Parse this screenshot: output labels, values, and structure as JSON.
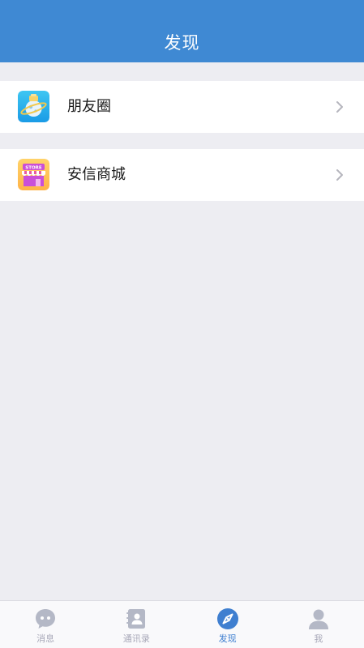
{
  "header": {
    "title": "发现"
  },
  "menu": [
    {
      "label": "朋友圈",
      "icon": "moments-planet-icon"
    },
    {
      "label": "安信商城",
      "icon": "store-shop-icon",
      "badge_text": "STORE"
    }
  ],
  "tabbar": {
    "tabs": [
      {
        "label": "消息",
        "icon": "chat-bubble-icon",
        "active": false
      },
      {
        "label": "通讯录",
        "icon": "contacts-book-icon",
        "active": false
      },
      {
        "label": "发现",
        "icon": "compass-icon",
        "active": true
      },
      {
        "label": "我",
        "icon": "person-icon",
        "active": false
      }
    ]
  },
  "colors": {
    "header_bg": "#3f89d3",
    "page_bg": "#ededf2",
    "active_tab": "#3f7fd0",
    "inactive_tab": "#a8a8b8"
  }
}
